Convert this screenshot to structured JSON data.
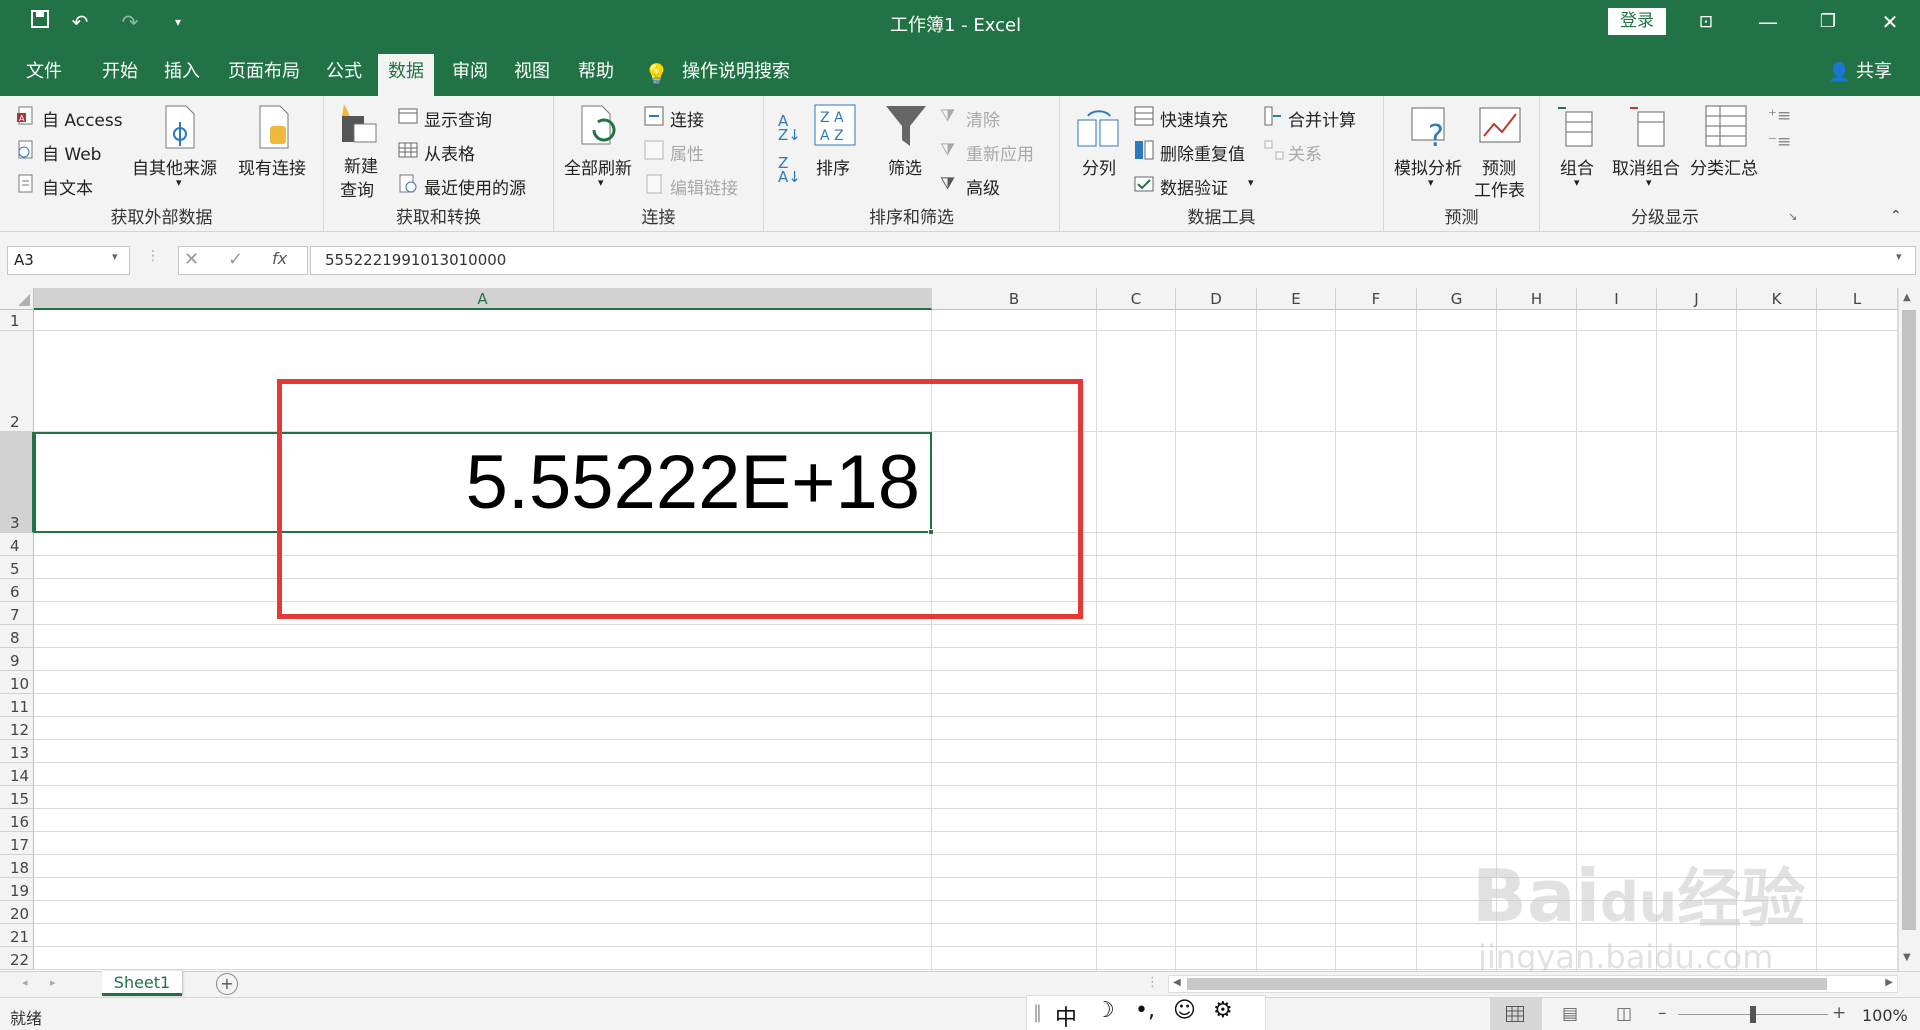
{
  "titlebar": {
    "doc_title": "工作簿1  -  Excel",
    "login_label": "登录"
  },
  "tabs": [
    {
      "label": "文件"
    },
    {
      "label": "开始"
    },
    {
      "label": "插入"
    },
    {
      "label": "页面布局"
    },
    {
      "label": "公式"
    },
    {
      "label": "数据"
    },
    {
      "label": "审阅"
    },
    {
      "label": "视图"
    },
    {
      "label": "帮助"
    }
  ],
  "search_label": "操作说明搜索",
  "share_label": "共享",
  "ribbon": {
    "get_external": {
      "access": "自 Access",
      "web": "自 Web",
      "text": "自文本",
      "other": "自其他来源",
      "existing": "现有连接",
      "group": "获取外部数据"
    },
    "transform": {
      "new_query_1": "新建",
      "new_query_2": "查询",
      "show_queries": "显示查询",
      "from_table": "从表格",
      "recent": "最近使用的源",
      "group": "获取和转换"
    },
    "connections": {
      "refresh_all": "全部刷新",
      "connections": "连接",
      "properties": "属性",
      "edit_links": "编辑链接",
      "group": "连接"
    },
    "sort_filter": {
      "sort": "排序",
      "filter": "筛选",
      "clear": "清除",
      "reapply": "重新应用",
      "advanced": "高级",
      "group": "排序和筛选"
    },
    "data_tools": {
      "text_to_columns": "分列",
      "flash_fill": "快速填充",
      "remove_dupes": "删除重复值",
      "validation": "数据验证",
      "consolidate": "合并计算",
      "relationships": "关系",
      "group": "数据工具"
    },
    "forecast": {
      "what_if": "模拟分析",
      "forecast_sheet_1": "预测",
      "forecast_sheet_2": "工作表",
      "group": "预测"
    },
    "outline": {
      "group_btn": "组合",
      "ungroup": "取消组合",
      "subtotal": "分类汇总",
      "group": "分级显示"
    }
  },
  "formula_bar": {
    "name_box": "A3",
    "formula": "5552221991013010000",
    "fx": "fx"
  },
  "columns": [
    "A",
    "B",
    "C",
    "D",
    "E",
    "F",
    "G",
    "H",
    "I",
    "J",
    "K",
    "L"
  ],
  "rows": [
    "1",
    "2",
    "3",
    "4",
    "5",
    "6",
    "7",
    "8",
    "9",
    "10",
    "11",
    "12",
    "13",
    "14",
    "15",
    "16",
    "17",
    "18",
    "19",
    "20",
    "21",
    "22"
  ],
  "cell_a3_display": "5.55222E+18",
  "sheet_tab": "Sheet1",
  "status": {
    "ready": "就绪",
    "zoom": "100%"
  },
  "ime": {
    "mode": "中"
  },
  "watermark": {
    "brand": "Bai",
    "brand2": "du",
    "cn": "经验",
    "url": "jingyan.baidu.com"
  },
  "colors": {
    "excel_green": "#217346",
    "highlight_red": "#e53935"
  }
}
